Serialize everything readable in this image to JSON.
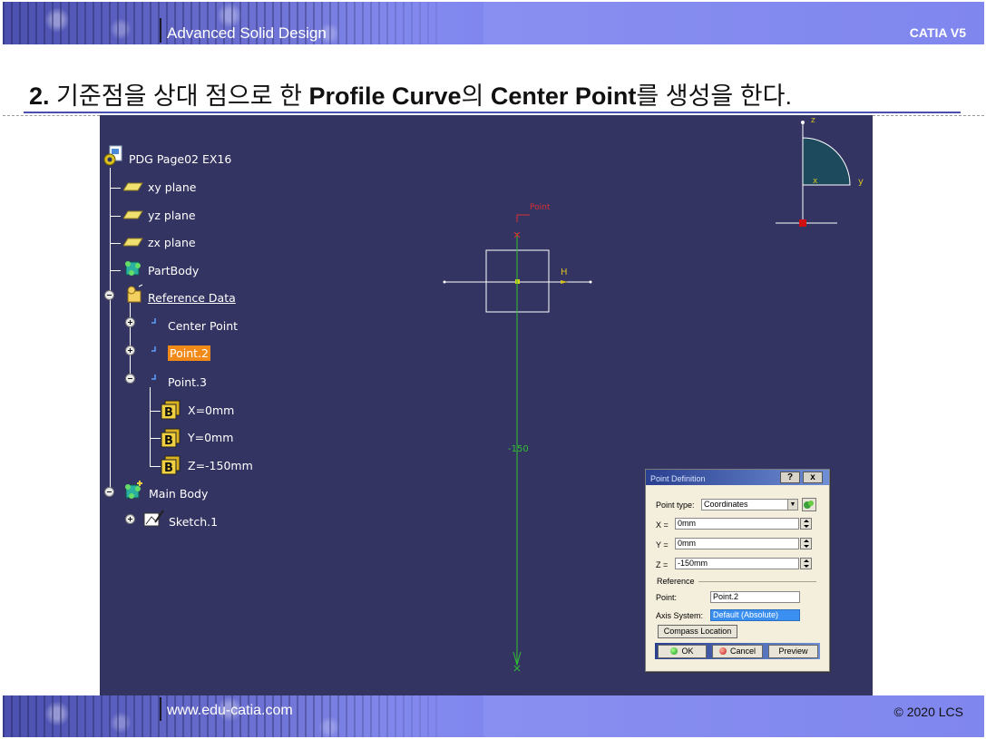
{
  "header": {
    "course_title": "Advanced Solid Design",
    "product": "CATIA V5"
  },
  "heading": {
    "step": "2.",
    "text_1": "기준점을 상대 점으로 한",
    "text_bold_1": "Profile Curve",
    "text_2": "의",
    "text_bold_2": "Center Point",
    "text_3": "를 생성을 한다."
  },
  "tree": {
    "root": "PDG Page02 EX16",
    "items": [
      {
        "label": "xy plane",
        "icon": "plane-icon"
      },
      {
        "label": "yz plane",
        "icon": "plane-icon"
      },
      {
        "label": "zx plane",
        "icon": "plane-icon"
      },
      {
        "label": "PartBody",
        "icon": "body-icon"
      },
      {
        "label": "Reference Data",
        "icon": "geometrical-set-icon"
      },
      {
        "label": "Center Point",
        "icon": "point-icon"
      },
      {
        "label": "Point.2",
        "icon": "point-icon",
        "selected": true
      },
      {
        "label": "Point.3",
        "icon": "point-icon"
      },
      {
        "label": "X=0mm",
        "icon": "parameter-icon"
      },
      {
        "label": "Y=0mm",
        "icon": "parameter-icon"
      },
      {
        "label": "Z=-150mm",
        "icon": "parameter-icon"
      },
      {
        "label": "Main Body",
        "icon": "body-icon"
      },
      {
        "label": "Sketch.1",
        "icon": "sketch-icon"
      }
    ]
  },
  "viewport": {
    "axis_h_label": "H",
    "profile_label": "Point",
    "dimension_label": "-150",
    "compass_z": "z",
    "compass_y": "y",
    "compass_x": "x"
  },
  "dialog": {
    "title": "Point Definition",
    "help_label": "?",
    "close_label": "x",
    "point_type_label": "Point type:",
    "point_type_value": "Coordinates",
    "x_label": "X =",
    "x_value": "0mm",
    "y_label": "Y =",
    "y_value": "0mm",
    "z_label": "Z =",
    "z_value": "-150mm",
    "reference_label": "Reference",
    "point_label": "Point:",
    "point_value": "Point.2",
    "axis_system_label": "Axis System:",
    "axis_system_value": "Default (Absolute)",
    "compass_location_label": "Compass Location",
    "ok_label": "OK",
    "cancel_label": "Cancel",
    "preview_label": "Preview"
  },
  "footer": {
    "website": "www.edu-catia.com",
    "copyright": "© 2020 LCS"
  },
  "colors": {
    "viewport_bg": "#343463",
    "banner_blue": "#7f86ee",
    "selection_orange": "#f28a1a",
    "heading_rule": "#4a4fb0",
    "curve_green": "#2fc12f",
    "axis_system_highlight": "#3a8ff0"
  }
}
